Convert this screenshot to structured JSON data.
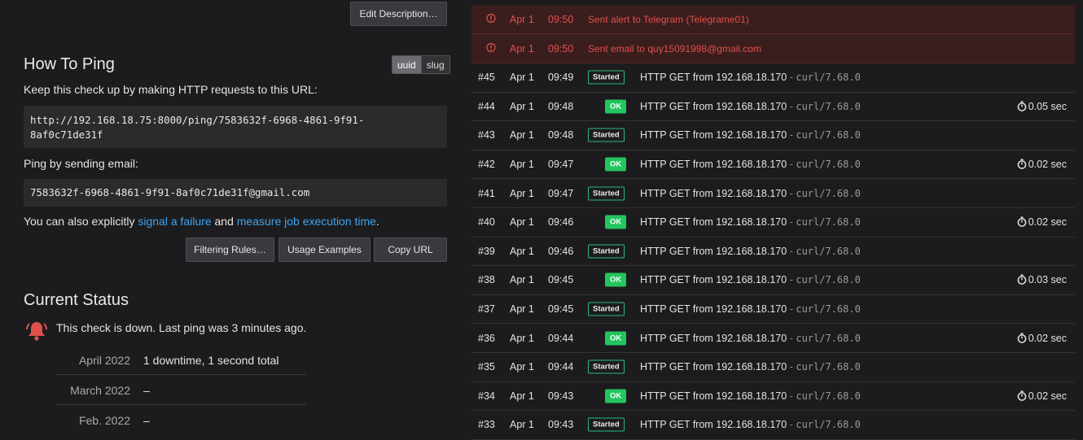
{
  "left": {
    "edit_description_label": "Edit Description…",
    "how_to_ping": {
      "title": "How To Ping",
      "format_toggle": {
        "uuid": "uuid",
        "slug": "slug",
        "selected": "uuid"
      },
      "intro": "Keep this check up by making HTTP requests to this URL:",
      "url_line1": "http://192.168.18.75:8000/ping/7583632f-6968-4861-9f91-",
      "url_line2": "8af0c71de31f",
      "email_intro": "Ping by sending email:",
      "email_address": "7583632f-6968-4861-9f91-8af0c71de31f@gmail.com",
      "also_prefix": "You can also explicitly ",
      "signal_failure_link": "signal a failure",
      "and_text": " and ",
      "measure_time_link": "measure job execution time",
      "period": ".",
      "buttons": {
        "filtering_rules": "Filtering Rules…",
        "usage_examples": "Usage Examples",
        "copy_url": "Copy URL"
      }
    },
    "current_status": {
      "title": "Current Status",
      "status_text": "This check is down. Last ping was 3 minutes ago.",
      "status_color": "#e0504b",
      "history": [
        {
          "month": "April 2022",
          "value": "1 downtime, 1 second total"
        },
        {
          "month": "March 2022",
          "value": "–"
        },
        {
          "month": "Feb. 2022",
          "value": "–"
        }
      ]
    }
  },
  "log": {
    "alerts": [
      {
        "date": "Apr 1",
        "time": "09:50",
        "text": "Sent alert to Telegram (Telegrame01)"
      },
      {
        "date": "Apr 1",
        "time": "09:50",
        "text": "Sent email to quy15091998@gmail.com"
      }
    ],
    "events": [
      {
        "num": "#45",
        "date": "Apr 1",
        "time": "09:49",
        "badge": "Started",
        "kind": "started",
        "desc": "HTTP GET from 192.168.18.170",
        "sep": "-",
        "ua": "curl/7.68.0",
        "duration": ""
      },
      {
        "num": "#44",
        "date": "Apr 1",
        "time": "09:48",
        "badge": "OK",
        "kind": "ok",
        "desc": "HTTP GET from 192.168.18.170",
        "sep": "-",
        "ua": "curl/7.68.0",
        "duration": "0.05 sec"
      },
      {
        "num": "#43",
        "date": "Apr 1",
        "time": "09:48",
        "badge": "Started",
        "kind": "started",
        "desc": "HTTP GET from 192.168.18.170",
        "sep": "-",
        "ua": "curl/7.68.0",
        "duration": ""
      },
      {
        "num": "#42",
        "date": "Apr 1",
        "time": "09:47",
        "badge": "OK",
        "kind": "ok",
        "desc": "HTTP GET from 192.168.18.170",
        "sep": "-",
        "ua": "curl/7.68.0",
        "duration": "0.02 sec"
      },
      {
        "num": "#41",
        "date": "Apr 1",
        "time": "09:47",
        "badge": "Started",
        "kind": "started",
        "desc": "HTTP GET from 192.168.18.170",
        "sep": "-",
        "ua": "curl/7.68.0",
        "duration": ""
      },
      {
        "num": "#40",
        "date": "Apr 1",
        "time": "09:46",
        "badge": "OK",
        "kind": "ok",
        "desc": "HTTP GET from 192.168.18.170",
        "sep": "-",
        "ua": "curl/7.68.0",
        "duration": "0.02 sec"
      },
      {
        "num": "#39",
        "date": "Apr 1",
        "time": "09:46",
        "badge": "Started",
        "kind": "started",
        "desc": "HTTP GET from 192.168.18.170",
        "sep": "-",
        "ua": "curl/7.68.0",
        "duration": ""
      },
      {
        "num": "#38",
        "date": "Apr 1",
        "time": "09:45",
        "badge": "OK",
        "kind": "ok",
        "desc": "HTTP GET from 192.168.18.170",
        "sep": "-",
        "ua": "curl/7.68.0",
        "duration": "0.03 sec"
      },
      {
        "num": "#37",
        "date": "Apr 1",
        "time": "09:45",
        "badge": "Started",
        "kind": "started",
        "desc": "HTTP GET from 192.168.18.170",
        "sep": "-",
        "ua": "curl/7.68.0",
        "duration": ""
      },
      {
        "num": "#36",
        "date": "Apr 1",
        "time": "09:44",
        "badge": "OK",
        "kind": "ok",
        "desc": "HTTP GET from 192.168.18.170",
        "sep": "-",
        "ua": "curl/7.68.0",
        "duration": "0.02 sec"
      },
      {
        "num": "#35",
        "date": "Apr 1",
        "time": "09:44",
        "badge": "Started",
        "kind": "started",
        "desc": "HTTP GET from 192.168.18.170",
        "sep": "-",
        "ua": "curl/7.68.0",
        "duration": ""
      },
      {
        "num": "#34",
        "date": "Apr 1",
        "time": "09:43",
        "badge": "OK",
        "kind": "ok",
        "desc": "HTTP GET from 192.168.18.170",
        "sep": "-",
        "ua": "curl/7.68.0",
        "duration": "0.02 sec"
      },
      {
        "num": "#33",
        "date": "Apr 1",
        "time": "09:43",
        "badge": "Started",
        "kind": "started",
        "desc": "HTTP GET from 192.168.18.170",
        "sep": "-",
        "ua": "curl/7.68.0",
        "duration": ""
      }
    ]
  }
}
